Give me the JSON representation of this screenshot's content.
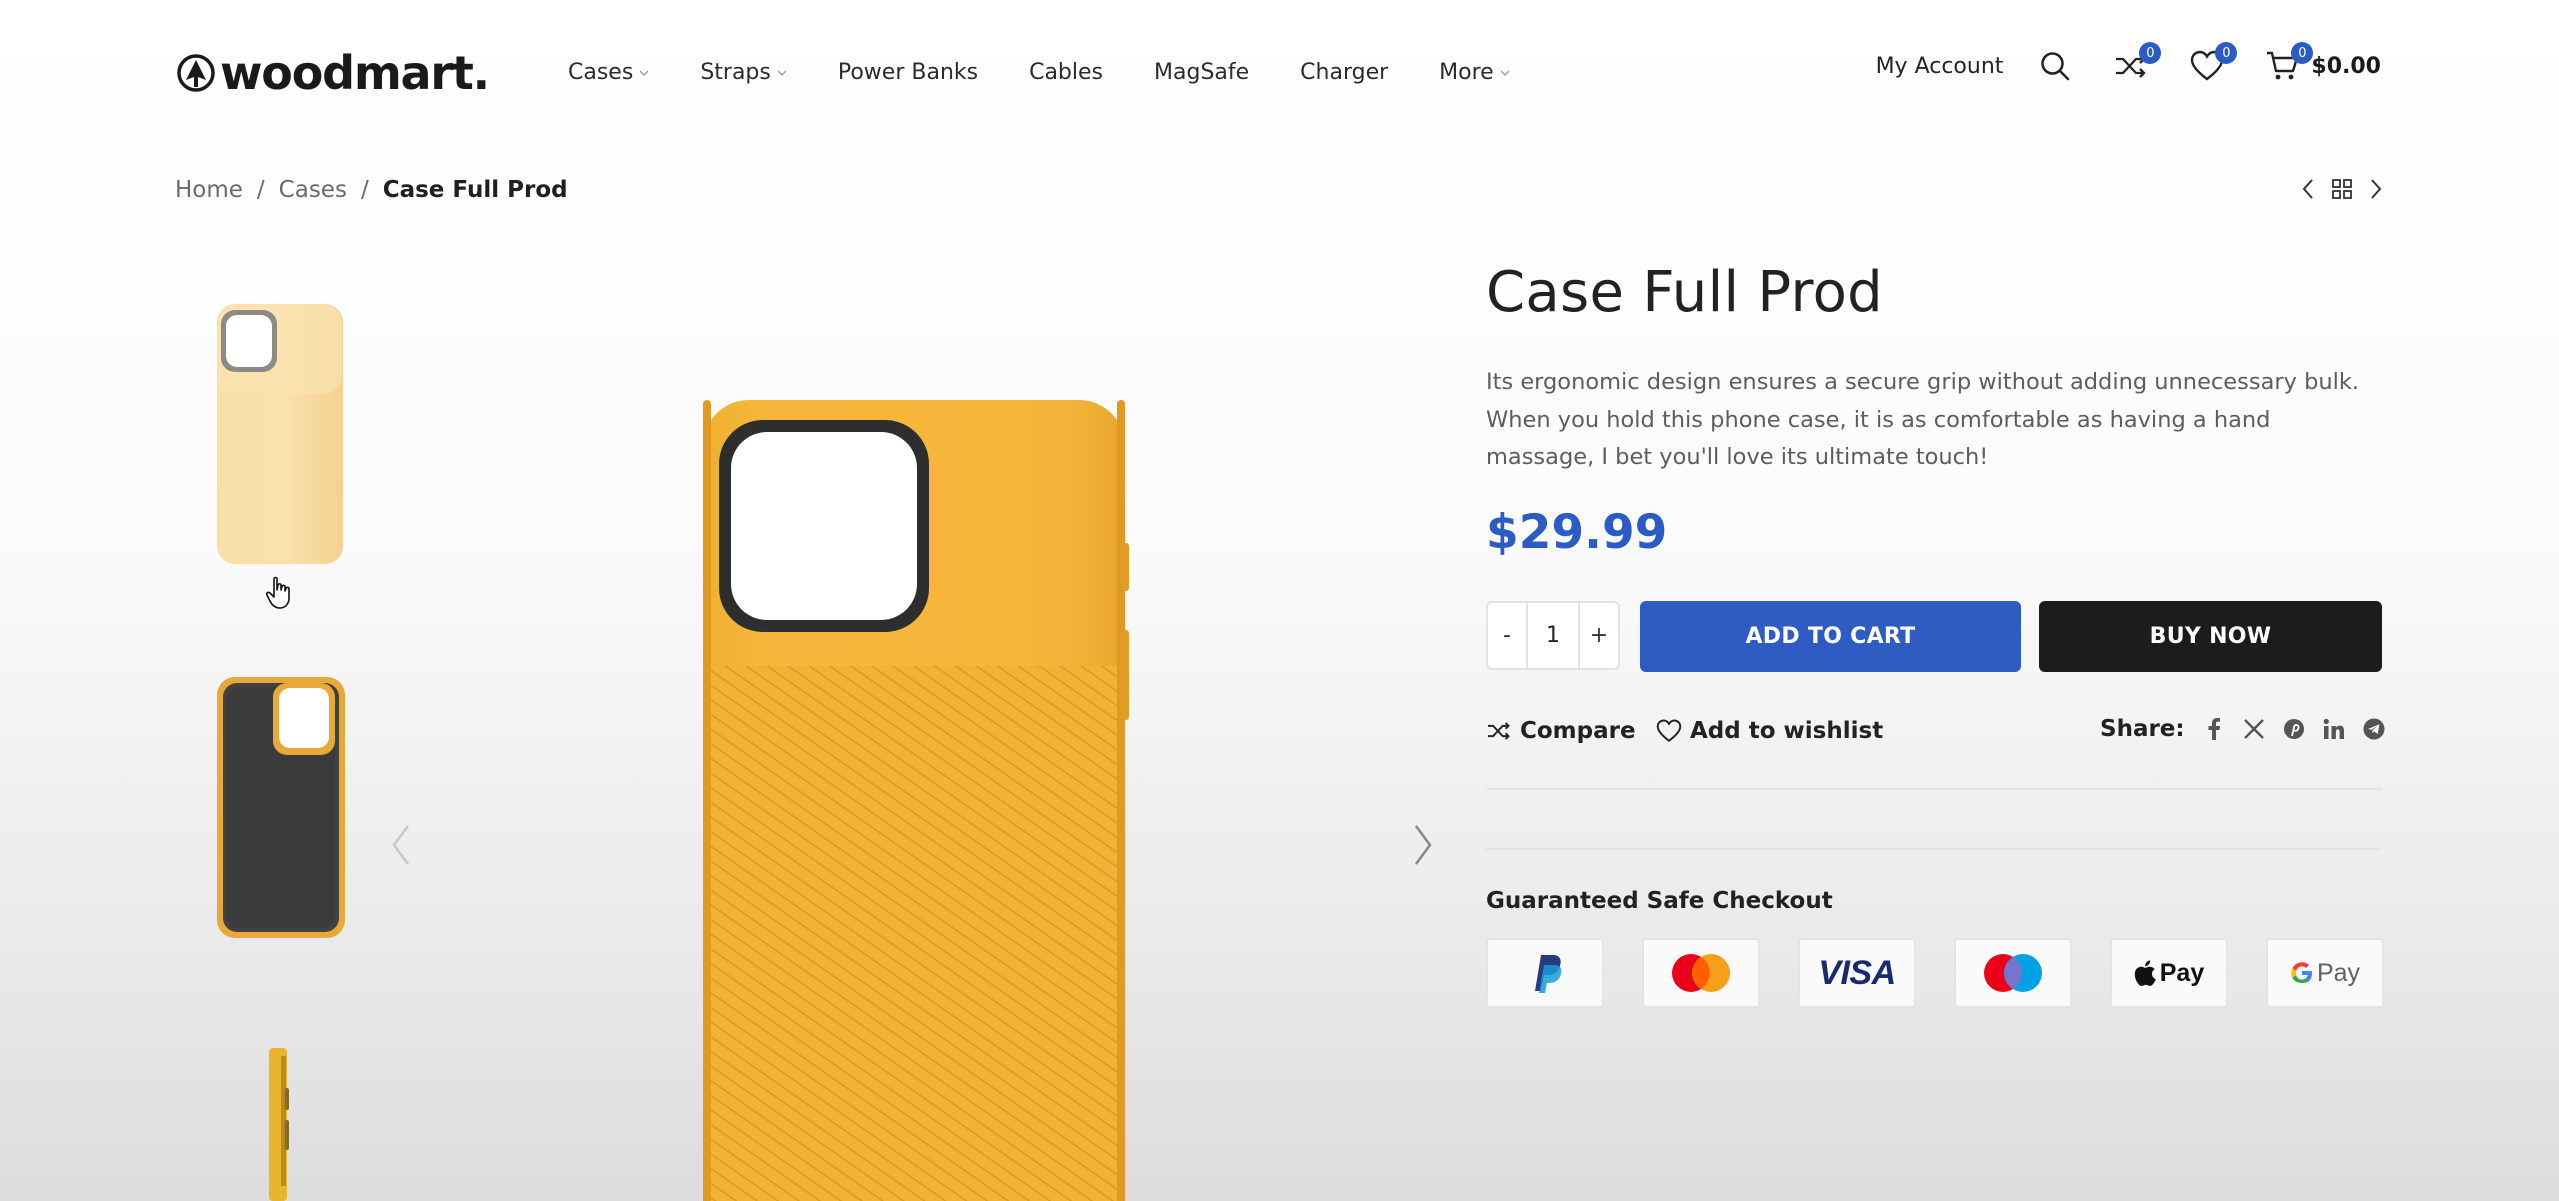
{
  "header": {
    "logo_text": "woodmart.",
    "nav": [
      {
        "label": "Cases",
        "has_dropdown": true
      },
      {
        "label": "Straps",
        "has_dropdown": true
      },
      {
        "label": "Power Banks",
        "has_dropdown": false
      },
      {
        "label": "Cables",
        "has_dropdown": false
      },
      {
        "label": "MagSafe",
        "has_dropdown": false
      },
      {
        "label": "Charger",
        "has_dropdown": false
      },
      {
        "label": "More",
        "has_dropdown": true
      }
    ],
    "my_account": "My Account",
    "compare_count": "0",
    "wishlist_count": "0",
    "cart_count": "0",
    "cart_total": "$0.00"
  },
  "breadcrumb": {
    "home": "Home",
    "sep1": "/",
    "category": "Cases",
    "sep2": "/",
    "current": "Case Full Prod"
  },
  "product": {
    "title": "Case Full Prod",
    "description": "Its ergonomic design ensures a secure grip without adding unnecessary bulk. When you hold this phone case, it is as comfortable as having a hand massage, I bet you'll love its ultimate touch!",
    "price": "$29.99",
    "quantity": "1",
    "qty_minus": "-",
    "qty_plus": "+",
    "add_to_cart": "ADD TO CART",
    "buy_now": "BUY NOW",
    "compare": "Compare",
    "wishlist": "Add to wishlist",
    "share_label": "Share:",
    "safe_checkout": "Guaranteed Safe Checkout"
  },
  "share_icons": [
    "facebook-icon",
    "x-icon",
    "pinterest-icon",
    "linkedin-icon",
    "telegram-icon"
  ],
  "payments": [
    "paypal",
    "mastercard",
    "visa",
    "maestro",
    "apple-pay",
    "google-pay"
  ],
  "payment_labels": {
    "visa": "VISA",
    "apple_pay": "Pay",
    "google_pay": "Pay"
  },
  "colors": {
    "accent": "#2f5cc3",
    "dark_button": "#1c1c1c",
    "case_yellow": "#f4b43a",
    "case_pale": "#f8d9a0"
  }
}
